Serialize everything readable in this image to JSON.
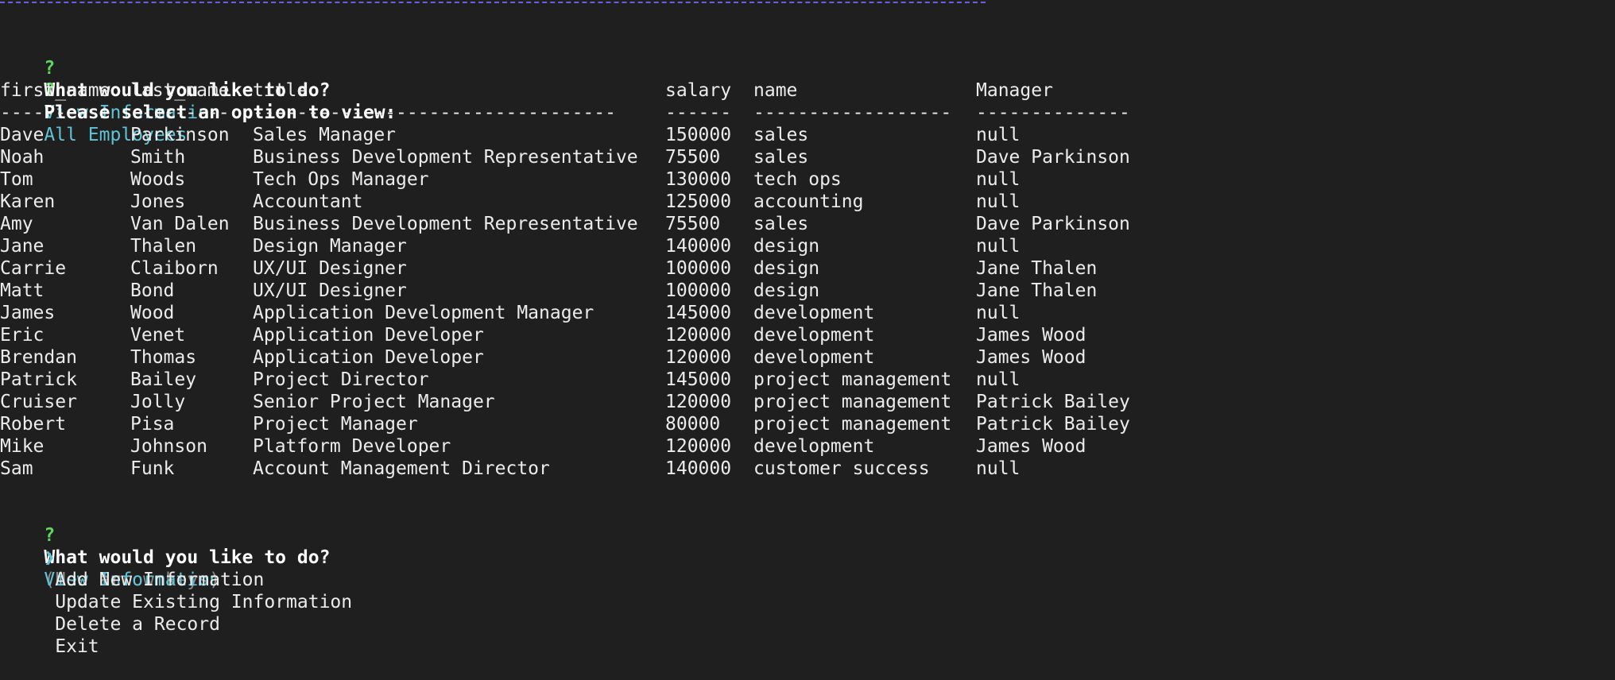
{
  "prompts": {
    "mark": "?",
    "first_question": "What would you like to do?",
    "first_answer": "View Information",
    "second_question": "Please select an option to view:",
    "second_answer": "All Employees",
    "third_question": "What would you like to do?",
    "third_hint": "(Use arrow keys)"
  },
  "table": {
    "headers": {
      "first_name": "first_name",
      "last_name": "last_name",
      "title": "title",
      "salary": "salary",
      "name": "name",
      "manager": "Manager"
    },
    "separators": {
      "first_name": "----------",
      "last_name": "---------",
      "title": "---------------------------------",
      "salary": "------",
      "name": "------------------",
      "manager": "--------------"
    },
    "rows": [
      [
        "Dave",
        "Parkinson",
        "Sales Manager",
        "150000",
        "sales",
        "null"
      ],
      [
        "Noah",
        "Smith",
        "Business Development Representative",
        "75500",
        "sales",
        "Dave Parkinson"
      ],
      [
        "Tom",
        "Woods",
        "Tech Ops Manager",
        "130000",
        "tech ops",
        "null"
      ],
      [
        "Karen",
        "Jones",
        "Accountant",
        "125000",
        "accounting",
        "null"
      ],
      [
        "Amy",
        "Van Dalen",
        "Business Development Representative",
        "75500",
        "sales",
        "Dave Parkinson"
      ],
      [
        "Jane",
        "Thalen",
        "Design Manager",
        "140000",
        "design",
        "null"
      ],
      [
        "Carrie",
        "Claiborn",
        "UX/UI Designer",
        "100000",
        "design",
        "Jane Thalen"
      ],
      [
        "Matt",
        "Bond",
        "UX/UI Designer",
        "100000",
        "design",
        "Jane Thalen"
      ],
      [
        "James",
        "Wood",
        "Application Development Manager",
        "145000",
        "development",
        "null"
      ],
      [
        "Eric",
        "Venet",
        "Application Developer",
        "120000",
        "development",
        "James Wood"
      ],
      [
        "Brendan",
        "Thomas",
        "Application Developer",
        "120000",
        "development",
        "James Wood"
      ],
      [
        "Patrick",
        "Bailey",
        "Project Director",
        "145000",
        "project management",
        "null"
      ],
      [
        "Cruiser",
        "Jolly",
        "Senior Project Manager",
        "120000",
        "project management",
        "Patrick Bailey"
      ],
      [
        "Robert",
        "Pisa",
        "Project Manager",
        "80000",
        "project management",
        "Patrick Bailey"
      ],
      [
        "Mike",
        "Johnson",
        "Platform Developer",
        "120000",
        "development",
        "James Wood"
      ],
      [
        "Sam",
        "Funk",
        "Account Management Director",
        "140000",
        "customer success",
        "null"
      ]
    ]
  },
  "menu": {
    "pointer": "❯",
    "items": [
      "View Information",
      "Add New Information",
      "Update Existing Information",
      "Delete a Record",
      "Exit"
    ]
  }
}
